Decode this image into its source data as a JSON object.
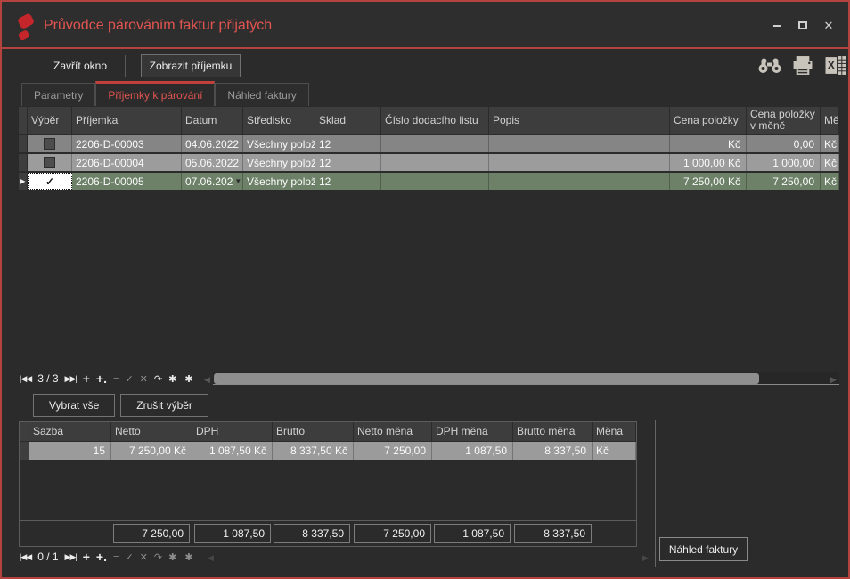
{
  "window": {
    "title": "Průvodce párováním faktur přijatých",
    "controls": {
      "minimize": "minimize",
      "maximize": "maximize",
      "close": "✕"
    }
  },
  "colors": {
    "accent_red": "#b4433f",
    "title_red": "#e25450",
    "logo_red": "#c4262b",
    "selected_row_green": "#6d8168",
    "row_gray_dark": "#858585",
    "row_gray_light": "#9c9c9c",
    "header_bg": "#3d3d3d"
  },
  "toolbar": {
    "close_window": "Zavřít okno",
    "show_receipt": "Zobrazit příjemku",
    "icons": [
      "binoculars-search-icon",
      "print-icon",
      "excel-export-icon"
    ]
  },
  "tabs": [
    {
      "label": "Parametry",
      "active": false
    },
    {
      "label": "Příjemky k párování",
      "active": true
    },
    {
      "label": "Náhled faktury",
      "active": false
    }
  ],
  "grid1": {
    "columns": [
      "Výběr",
      "Příjemka",
      "Datum",
      "Středisko",
      "Sklad",
      "Číslo dodacího listu",
      "Popis",
      "Cena položky",
      "Cena položky v měně",
      "Měna"
    ],
    "rows": [
      {
        "selected": false,
        "prijemka": "2206-D-00003",
        "datum": "04.06.2022",
        "stredisko": "Všechny položky",
        "sklad": "12",
        "cislo": "",
        "popis": "",
        "cena": "Kč",
        "cena_mena": "0,00",
        "mena": "Kč"
      },
      {
        "selected": false,
        "prijemka": "2206-D-00004",
        "datum": "05.06.2022",
        "stredisko": "Všechny položky",
        "sklad": "12",
        "cislo": "",
        "popis": "",
        "cena": "1 000,00 Kč",
        "cena_mena": "1 000,00",
        "mena": "Kč"
      },
      {
        "selected": true,
        "prijemka": "2206-D-00005",
        "datum": "07.06.202",
        "stredisko": "Všechny položky",
        "sklad": "12",
        "cislo": "",
        "popis": "",
        "cena": "7 250,00 Kč",
        "cena_mena": "7 250,00",
        "mena": "Kč"
      }
    ],
    "navigator": {
      "position": "3 / 3",
      "first": "|◀◀",
      "last": "▶▶|",
      "buttons": [
        {
          "name": "add",
          "glyph": "+",
          "bright": true
        },
        {
          "name": "add-child",
          "glyph": "+.",
          "bright": true
        },
        {
          "name": "delete",
          "glyph": "−",
          "bright": false
        },
        {
          "name": "post",
          "glyph": "✓",
          "bright": false
        },
        {
          "name": "cancel",
          "glyph": "✕",
          "bright": false
        },
        {
          "name": "refresh",
          "glyph": "↷",
          "bright": true
        },
        {
          "name": "filter",
          "glyph": "✱",
          "bright": true
        },
        {
          "name": "filter-edit",
          "glyph": "'✱",
          "bright": true
        }
      ]
    }
  },
  "selection_buttons": {
    "select_all": "Vybrat vše",
    "clear_selection": "Zrušit výběr"
  },
  "grid2": {
    "columns": [
      "Sazba",
      "Netto",
      "DPH",
      "Brutto",
      "Netto měna",
      "DPH měna",
      "Brutto měna",
      "Měna"
    ],
    "row": {
      "sazba": "15",
      "netto": "7 250,00 Kč",
      "dph": "1 087,50 Kč",
      "brutto": "8 337,50 Kč",
      "netto_mena": "7 250,00",
      "dph_mena": "1 087,50",
      "brutto_mena": "8 337,50",
      "mena": "Kč"
    },
    "totals": [
      "7 250,00",
      "1 087,50",
      "8 337,50",
      "7 250,00",
      "1 087,50",
      "8 337,50"
    ],
    "navigator": {
      "position": "0 / 1",
      "first": "|◀◀",
      "last": "▶▶|",
      "buttons": [
        {
          "name": "add",
          "glyph": "+",
          "bright": true
        },
        {
          "name": "add-child",
          "glyph": "+.",
          "bright": true
        },
        {
          "name": "delete",
          "glyph": "−",
          "bright": false
        },
        {
          "name": "post",
          "glyph": "✓",
          "bright": false
        },
        {
          "name": "cancel",
          "glyph": "✕",
          "bright": false
        },
        {
          "name": "refresh",
          "glyph": "↷",
          "bright": false
        },
        {
          "name": "filter",
          "glyph": "✱",
          "bright": false
        },
        {
          "name": "filter-edit",
          "glyph": "'✱",
          "bright": false
        }
      ]
    }
  },
  "preview_button": "Náhled faktury"
}
